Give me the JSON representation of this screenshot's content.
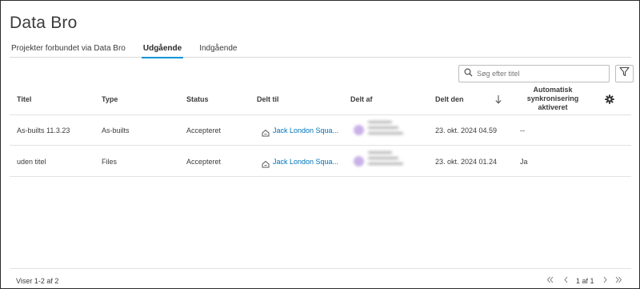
{
  "app": {
    "title": "Data Bro"
  },
  "tabs": [
    {
      "label": "Projekter forbundet via Data Bro",
      "active": false
    },
    {
      "label": "Udgående",
      "active": true
    },
    {
      "label": "Indgående",
      "active": false
    }
  ],
  "search": {
    "placeholder": "Søg efter titel",
    "icon": "search-icon"
  },
  "filter": {
    "icon": "filter-icon"
  },
  "table": {
    "headers": {
      "title": "Titel",
      "type": "Type",
      "status": "Status",
      "shared_to": "Delt til",
      "shared_by": "Delt af",
      "shared_on": "Delt den",
      "auto_sync": "Automatisk synkronisering aktiveret"
    },
    "sort_icon": "arrow-down-icon",
    "settings_icon": "gear-icon",
    "rows": [
      {
        "title": "As-builts 11.3.23",
        "type": "As-builts",
        "status": "Accepteret",
        "shared_to": "Jack London Squa...",
        "shared_on": "23. okt. 2024 04.59",
        "auto_sync": "--"
      },
      {
        "title": "uden titel",
        "type": "Files",
        "status": "Accepteret",
        "shared_to": "Jack London Squa...",
        "shared_on": "23. okt. 2024 01.24",
        "auto_sync": "Ja"
      }
    ]
  },
  "footer": {
    "count_text": "Viser 1-2 af 2",
    "page_label": "1 af 1"
  },
  "colors": {
    "accent": "#0696d7",
    "link": "#0073b8",
    "avatar": "#c9b1e8"
  }
}
